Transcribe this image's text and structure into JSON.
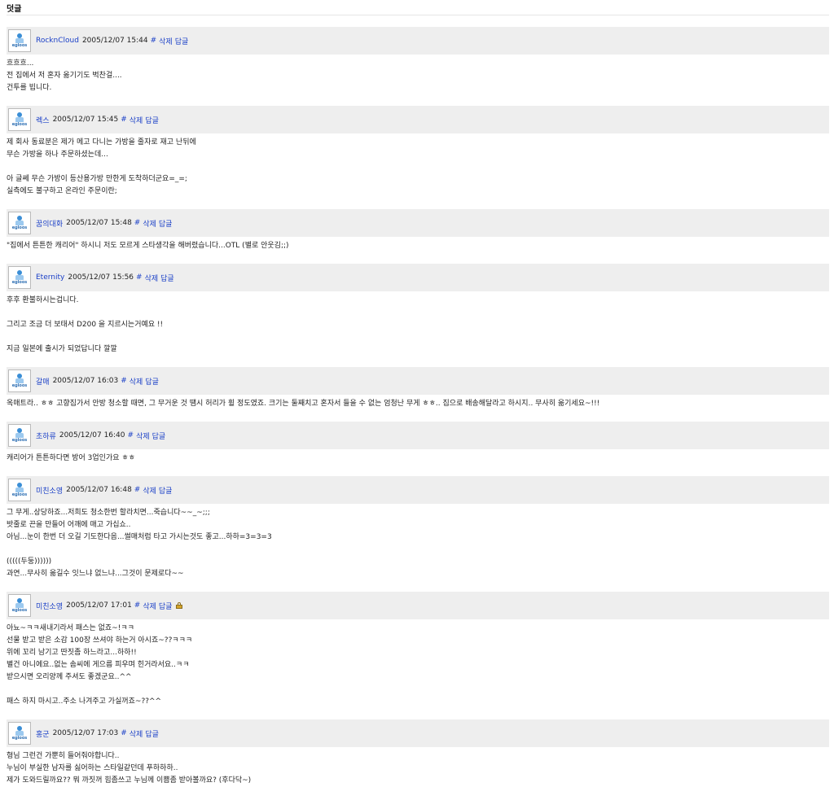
{
  "header": {
    "title": "덧글"
  },
  "actions": {
    "hash": "#",
    "delete": "삭제",
    "reply": "답글"
  },
  "avatar_label": "egloos",
  "comments": [
    {
      "author": "RocknCloud",
      "date": "2005/12/07 15:44",
      "locked": false,
      "body": "흐흐흐...\n전 집에서 저 혼자 옮기기도 벅찬걸....\n건투를 빕니다."
    },
    {
      "author": "렉스",
      "date": "2005/12/07 15:45",
      "locked": false,
      "body": "제 회사 동료분은 제가 메고 다니는 가방을 줄자로 재고 난뒤에\n무슨 가방을 하나 주문하셨는데...\n\n아 글쎄 무슨 가방이 등산용가방 만한게 도착하더군요=_=;\n실측에도 불구하고 온라인 주문이란;"
    },
    {
      "author": "꿈의대화",
      "date": "2005/12/07 15:48",
      "locked": false,
      "body": "\"집에서 튼튼한 캐리어\" 하시니 저도 모르게 스타생각을 해버렸습니다...OTL (별로 안웃김;;)"
    },
    {
      "author": "Eternity",
      "date": "2005/12/07 15:56",
      "locked": false,
      "body": "후후 환불하시는겁니다.\n\n그리고 조금 더 보태서 D200 을 지르시는거예요 !!\n\n지금 일본에 출시가 되었답니다 깔깔"
    },
    {
      "author": "갈매",
      "date": "2005/12/07 16:03",
      "locked": false,
      "body": "옥매트라.. ㅎㅎ 고향집가서 안방 청소할 때면, 그 무거운 것 땜시 허리가 휠 정도였죠. 크기는 둘째치고 혼자서 들을 수 없는 엄청난 무게 ㅎㅎ.. 집으로 배송해달라고 하시지.. 무사히 옮기세요~!!!"
    },
    {
      "author": "초하류",
      "date": "2005/12/07 16:40",
      "locked": false,
      "body": "캐리어가 튼튼하다면 방어 3업인가요 ㅎㅎ"
    },
    {
      "author": "미친소영",
      "date": "2005/12/07 16:48",
      "locked": false,
      "body": "그 무게..상당하죠...저희도 청소한번 할라치면...죽습니다~~_~;;;\n밧줄로 끈을 만들어 어깨에 매고 가십쇼..\n아님...눈이 한번 더 오길 기도한다음...썰매처럼 타고 가시는것도 좋고...하하=3=3=3\n\n(((((두둥))))))\n과연...무사히 옮길수 잇느냐 없느냐...그것이 문제로다~~"
    },
    {
      "author": "미친소영",
      "date": "2005/12/07 17:01",
      "locked": true,
      "body": "아뇨~ㅋㅋ새내기라서 패스는 없죠~!ㅋㅋ\n선물 받고 받은 소감 100장 쓰셔야 하는거 아시죠~??ㅋㅋㅋ\n위에 꼬리 남기고 딴짓좀 하느라고...하하!!\n별건 아니에요..없는 솜씨에 게으름 피우며 힌거라서요..ㅋㅋ\n받으시면 오리양께 주셔도 좋겠군요..^^\n\n패스 하지 마시고..주소 나겨주고 가실꺼죠~??^^"
    },
    {
      "author": "홍군",
      "date": "2005/12/07 17:03",
      "locked": false,
      "body": "형님 그런건 가뿐히 들어줘야합니다..\n누님이 부실한 남자를 싫어하는 스타일같던데 푸하하하..\n제가 도와드릴까요?? 뭐 까짓꺼 힘좀쓰고 누님께 이쁨좀 받아볼까요? (후다닥~)"
    }
  ]
}
